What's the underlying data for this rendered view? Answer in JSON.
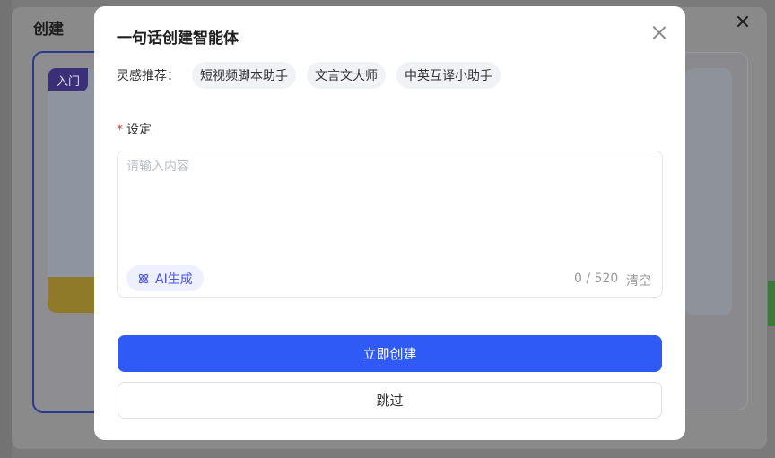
{
  "background": {
    "title": "创建",
    "card_tag": "入门"
  },
  "modal": {
    "title": "一句话创建智能体",
    "inspiration_label": "灵感推荐：",
    "inspiration_chips": [
      "短视频脚本助手",
      "文言文大师",
      "中英互译小助手"
    ],
    "field_label": "设定",
    "required_mark": "*",
    "input_placeholder": "请输入内容",
    "input_value": "",
    "ai_button_label": "AI生成",
    "counter": "0 / 520",
    "clear_label": "清空",
    "primary_button": "立即创建",
    "secondary_button": "跳过"
  },
  "icons": {
    "close": "close-icon",
    "ai": "atom-icon"
  },
  "colors": {
    "primary": "#2f5af5",
    "ai_accent": "#4a55e6",
    "required": "#e53935"
  }
}
